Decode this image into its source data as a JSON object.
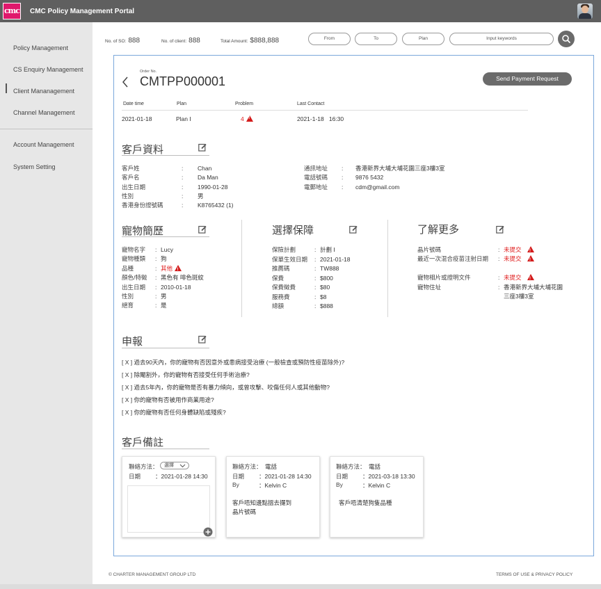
{
  "app": {
    "logo_text": "cmc",
    "title": "CMC Policy Management Portal"
  },
  "sidebar": {
    "items": [
      {
        "label": "Policy Management"
      },
      {
        "label": "CS Enquiry Management"
      },
      {
        "label": "Client Mananagement"
      },
      {
        "label": "Channel Management"
      },
      {
        "label": "Account Management"
      },
      {
        "label": "System Setting"
      }
    ]
  },
  "stats": {
    "so_label": "No. of SO:",
    "so_value": "888",
    "client_label": "No. of client:",
    "client_value": "888",
    "amount_label": "Total Amount:",
    "amount_value": "$888,888"
  },
  "filters": {
    "from": "From",
    "to": "To",
    "plan": "Plan",
    "keyword_placeholder": "Input keywords"
  },
  "order": {
    "label": "Order No.",
    "number": "CMTPP000001",
    "send_button": "Send Payment Request"
  },
  "summary": {
    "headers": [
      "Date time",
      "Plan",
      "Problem",
      "Last Contact"
    ],
    "values": {
      "date": "2021-01-18",
      "plan": "Plan I",
      "problem": "4",
      "last_contact": "2021-1-18   16:30"
    }
  },
  "customer": {
    "title": "客戶資料",
    "fields": [
      {
        "label": "客戶姓",
        "value": "Chan"
      },
      {
        "label": "客戶名",
        "value": "Da Man"
      },
      {
        "label": "出生日期",
        "value": "1990-01-28"
      },
      {
        "label": "性別",
        "value": "男"
      },
      {
        "label": "香港身份證號碼",
        "value": "K8765432 (1)"
      }
    ],
    "contact": [
      {
        "label": "通訊地址",
        "value": "香港新界大埔大埔花園三座3樓3室"
      },
      {
        "label": "電話號碼",
        "value": "9876 5432"
      },
      {
        "label": "電郵地址",
        "value": "cdm@gmail.com"
      }
    ]
  },
  "pet": {
    "title": "寵物簡歷",
    "fields": [
      {
        "label": "寵物名字",
        "value": "Lucy"
      },
      {
        "label": "寵物種類",
        "value": "狗"
      },
      {
        "label": "品種",
        "value": "其他"
      },
      {
        "label": "顏色/特徵",
        "value": "黑色有 啡色斑紋"
      },
      {
        "label": "出生日期",
        "value": "2010-01-18"
      },
      {
        "label": "性別",
        "value": "男"
      },
      {
        "label": "絕育",
        "value": "是"
      }
    ]
  },
  "plan": {
    "title": "選擇保障",
    "fields": [
      {
        "label": "保險計劃",
        "value": "計劃 I"
      },
      {
        "label": "保單生效日期",
        "value": "2021-01-18"
      },
      {
        "label": "推薦碼",
        "value": "TW888"
      },
      {
        "label": "保費",
        "value": "$800"
      },
      {
        "label": "保費徵費",
        "value": "$80"
      },
      {
        "label": "服務費",
        "value": "$8"
      },
      {
        "label": "總額",
        "value": "$888"
      }
    ]
  },
  "more": {
    "title": "了解更多",
    "fields": [
      {
        "label": "晶片號碼",
        "value": "未提交"
      },
      {
        "label": "最近一次混合疫苗注射日期",
        "value": "未提交"
      },
      {
        "label": "寵物相片或證明文件",
        "value": "未提交"
      },
      {
        "label": "寵物住址",
        "value": "香港新界大埔大埔花園",
        "value2": "三座3樓3室"
      }
    ]
  },
  "declaration": {
    "title": "申報",
    "items": [
      "[ X ] 過去90天內，你的寵物有否因意外或患病接受治療 (一般檢查或預防性疫苗除外)?",
      "[ X ] 除閹割外，你的寵物有否接受任何手術治療?",
      "[ X ] 過去5年內，你的寵物是否有暴力傾向，或曾攻擊、咬傷任何人或其他動物?",
      "[ X ] 你的寵物有否被用作商業用途?",
      "[ X ] 你的寵物有否任何身體缺陷或殘疾?"
    ]
  },
  "remarks": {
    "title": "客戶備註",
    "new_note": {
      "method_label": "聯絡方法：",
      "method_select": "選擇",
      "date_label": "日期",
      "date_value": "：2021-01-28 14:30"
    },
    "notes": [
      {
        "method_label": "聯絡方法：",
        "method": "電話",
        "date_label": "日期",
        "date": "：2021-01-28 14:30",
        "by_label": "By",
        "by": "：Kelvin C",
        "text1": "客戶唔知邊點搵去攞到",
        "text2": "晶片號碼"
      },
      {
        "method_label": "聯絡方法：",
        "method": "電話",
        "date_label": "日期",
        "date": "：2021-03-18 13:30",
        "by_label": "By",
        "by": "：Kelvin C",
        "text1": "客戶唔清楚狗隻品種",
        "text2": ""
      }
    ]
  },
  "footer": {
    "left": "© CHARTER MANAGEMENT GROUP LTD",
    "right": "TERMS OF USE & PRIVACY POLICY"
  },
  "colors": {
    "accent": "#e0186c",
    "warning": "#d31b1b",
    "card_border": "#7aa7db",
    "topbar": "#5f5f5f"
  }
}
